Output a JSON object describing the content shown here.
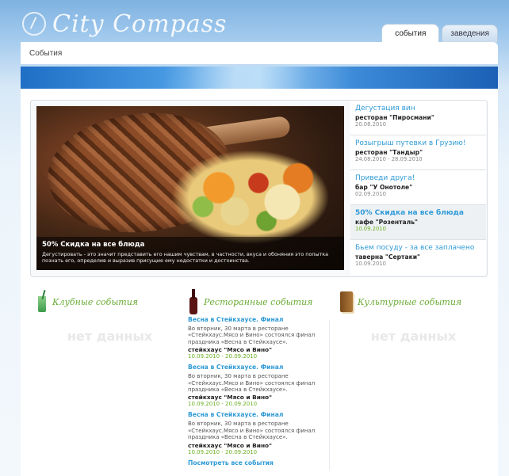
{
  "header": {
    "logo_text": "City Compass",
    "tabs": [
      {
        "label": "события",
        "active": true
      },
      {
        "label": "заведения",
        "active": false
      }
    ]
  },
  "breadcrumb": "События",
  "slider": {
    "featured": {
      "title": "50% Скидка на все блюда",
      "text": "Дегустировать - это значит представить его нашим чувствам, в частности, вкуса и обоняния это попытка познать его, определив и выразив присущие ему недостатки и достоинства."
    },
    "events": [
      {
        "title": "Дегустация вин",
        "place": "ресторан \"Пиросмани\"",
        "date": "20.08.2010",
        "active": false
      },
      {
        "title": "Розыгрыш путевки в Грузию!",
        "place": "ресторан \"Тандыр\"",
        "date": "24.08.2010 - 28.09.2010",
        "active": false
      },
      {
        "title": "Приведи друга!",
        "place": "бар \"У Онотоле\"",
        "date": "02.09.2010",
        "active": false
      },
      {
        "title": "50% Скидка на все блюда",
        "place": "кафе \"Розенталь\"",
        "date": "10.09.2010",
        "active": true
      },
      {
        "title": "Бьем посуду - за все заплачено",
        "place": "таверна \"Сертаки\"",
        "date": "10.09.2010",
        "active": false
      }
    ]
  },
  "columns": {
    "club": {
      "title": "Клубные события",
      "empty": "нет данных"
    },
    "restaurant": {
      "title": "Ресторанные события",
      "items": [
        {
          "title": "Весна в Стейкхаусе. Финал",
          "text": "Во вторник, 30 марта в ресторане «Стейкхаус.Мясо и Вино» состоялся финал праздника «Весна в Стейкхаусе».",
          "place": "стейкхаус \"Мясо и Вино\"",
          "date": "10.09.2010 - 20.09.2010"
        },
        {
          "title": "Весна в Стейкхаусе. Финал",
          "text": "Во вторник, 30 марта в ресторане «Стейкхаус.Мясо и Вино» состоялся финал праздника «Весна в Стейкхаусе».",
          "place": "стейкхаус \"Мясо и Вино\"",
          "date": "10.09.2010 - 20.09.2010"
        },
        {
          "title": "Весна в Стейкхаусе. Финал",
          "text": "Во вторник, 30 марта в ресторане «Стейкхаус.Мясо и Вино» состоялся финал праздника «Весна в Стейкхаусе».",
          "place": "стейкхаус \"Мясо и Вино\"",
          "date": "10.09.2010 - 20.09.2010"
        }
      ],
      "all_link": "Посмотреть все события"
    },
    "culture": {
      "title": "Культурные события",
      "empty": "нет данных"
    }
  },
  "icons": {
    "club": "cocktail-glass-icon",
    "restaurant": "wine-bottle-icon",
    "culture": "book-icon"
  }
}
